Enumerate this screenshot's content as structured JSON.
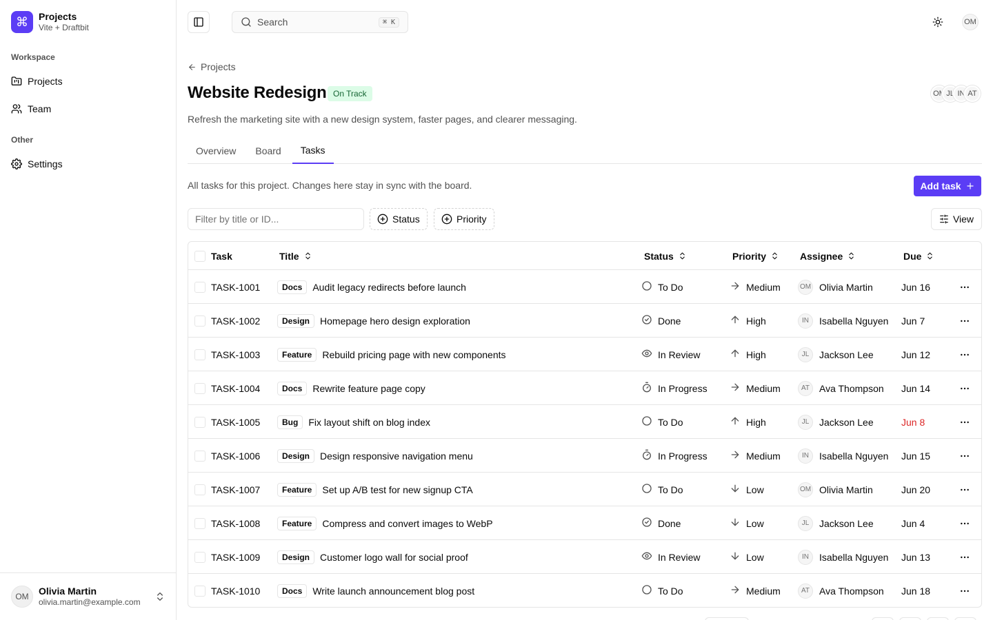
{
  "brand": {
    "title": "Projects",
    "subtitle": "Vite + Draftbit",
    "logo_glyph": "⌘"
  },
  "sidebar": {
    "groups": [
      {
        "label": "Workspace",
        "items": [
          {
            "label": "Projects",
            "icon": "folder-kanban-icon"
          },
          {
            "label": "Team",
            "icon": "users-icon"
          }
        ]
      },
      {
        "label": "Other",
        "items": [
          {
            "label": "Settings",
            "icon": "gear-icon"
          }
        ]
      }
    ],
    "user": {
      "initials": "OM",
      "name": "Olivia Martin",
      "email": "olivia.martin@example.com"
    }
  },
  "topbar": {
    "search_placeholder": "Search",
    "search_shortcut": "⌘ K",
    "avatar_initials": "OM"
  },
  "header": {
    "breadcrumb": "Projects",
    "title": "Website Redesign",
    "status": "On Track",
    "description": "Refresh the marketing site with a new design system, faster pages, and clearer messaging.",
    "members": [
      "OM",
      "JL",
      "IN",
      "AT"
    ]
  },
  "tabs": [
    {
      "label": "Overview",
      "active": false
    },
    {
      "label": "Board",
      "active": false
    },
    {
      "label": "Tasks",
      "active": true
    }
  ],
  "tasks_section": {
    "description": "All tasks for this project. Changes here stay in sync with the board.",
    "add_label": "Add task",
    "filter_placeholder": "Filter by title or ID...",
    "facets": [
      "Status",
      "Priority"
    ],
    "view_label": "View"
  },
  "table": {
    "columns": {
      "task": "Task",
      "title": "Title",
      "status": "Status",
      "priority": "Priority",
      "assignee": "Assignee",
      "due": "Due"
    },
    "rows": [
      {
        "id": "TASK-1001",
        "label": "Docs",
        "title": "Audit legacy redirects before launch",
        "status": "To Do",
        "priority": "Medium",
        "assignee_initials": "OM",
        "assignee": "Olivia Martin",
        "due": "Jun 16",
        "overdue": false
      },
      {
        "id": "TASK-1002",
        "label": "Design",
        "title": "Homepage hero design exploration",
        "status": "Done",
        "priority": "High",
        "assignee_initials": "IN",
        "assignee": "Isabella Nguyen",
        "due": "Jun 7",
        "overdue": false
      },
      {
        "id": "TASK-1003",
        "label": "Feature",
        "title": "Rebuild pricing page with new components",
        "status": "In Review",
        "priority": "High",
        "assignee_initials": "JL",
        "assignee": "Jackson Lee",
        "due": "Jun 12",
        "overdue": false
      },
      {
        "id": "TASK-1004",
        "label": "Docs",
        "title": "Rewrite feature page copy",
        "status": "In Progress",
        "priority": "Medium",
        "assignee_initials": "AT",
        "assignee": "Ava Thompson",
        "due": "Jun 14",
        "overdue": false
      },
      {
        "id": "TASK-1005",
        "label": "Bug",
        "title": "Fix layout shift on blog index",
        "status": "To Do",
        "priority": "High",
        "assignee_initials": "JL",
        "assignee": "Jackson Lee",
        "due": "Jun 8",
        "overdue": true
      },
      {
        "id": "TASK-1006",
        "label": "Design",
        "title": "Design responsive navigation menu",
        "status": "In Progress",
        "priority": "Medium",
        "assignee_initials": "IN",
        "assignee": "Isabella Nguyen",
        "due": "Jun 15",
        "overdue": false
      },
      {
        "id": "TASK-1007",
        "label": "Feature",
        "title": "Set up A/B test for new signup CTA",
        "status": "To Do",
        "priority": "Low",
        "assignee_initials": "OM",
        "assignee": "Olivia Martin",
        "due": "Jun 20",
        "overdue": false
      },
      {
        "id": "TASK-1008",
        "label": "Feature",
        "title": "Compress and convert images to WebP",
        "status": "Done",
        "priority": "Low",
        "assignee_initials": "JL",
        "assignee": "Jackson Lee",
        "due": "Jun 4",
        "overdue": false
      },
      {
        "id": "TASK-1009",
        "label": "Design",
        "title": "Customer logo wall for social proof",
        "status": "In Review",
        "priority": "Low",
        "assignee_initials": "IN",
        "assignee": "Isabella Nguyen",
        "due": "Jun 13",
        "overdue": false
      },
      {
        "id": "TASK-1010",
        "label": "Docs",
        "title": "Write launch announcement blog post",
        "status": "To Do",
        "priority": "Medium",
        "assignee_initials": "AT",
        "assignee": "Ava Thompson",
        "due": "Jun 18",
        "overdue": false
      }
    ]
  },
  "colors": {
    "accent": "#5b3df5",
    "success_bg": "#dcfce7",
    "success_text": "#166534",
    "overdue": "#dc2626",
    "border": "#e5e5e5",
    "muted": "#525252"
  }
}
